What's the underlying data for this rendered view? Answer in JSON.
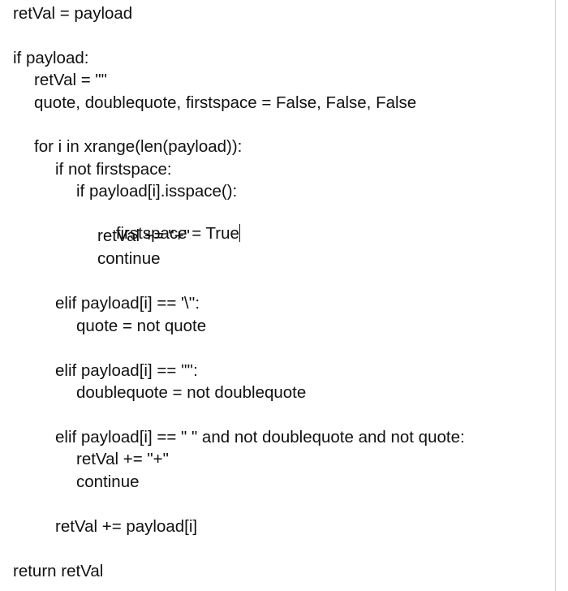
{
  "code": {
    "lines": [
      "retVal = payload",
      "",
      "if payload:",
      "retVal = \"\"",
      "quote, doublequote, firstspace = False, False, False",
      "",
      "for i in xrange(len(payload)):",
      "if not firstspace:",
      "if payload[i].isspace():",
      "firstspace = True",
      "retVal += \"+\"",
      "continue",
      "",
      "elif payload[i] == '\\'':",
      "quote = not quote",
      "",
      "elif payload[i] == '\"':",
      "doublequote = not doublequote",
      "",
      "elif payload[i] == \" \" and not doublequote and not quote:",
      "retVal += \"+\"",
      "continue",
      "",
      "retVal += payload[i]",
      "",
      "return retVal"
    ]
  }
}
